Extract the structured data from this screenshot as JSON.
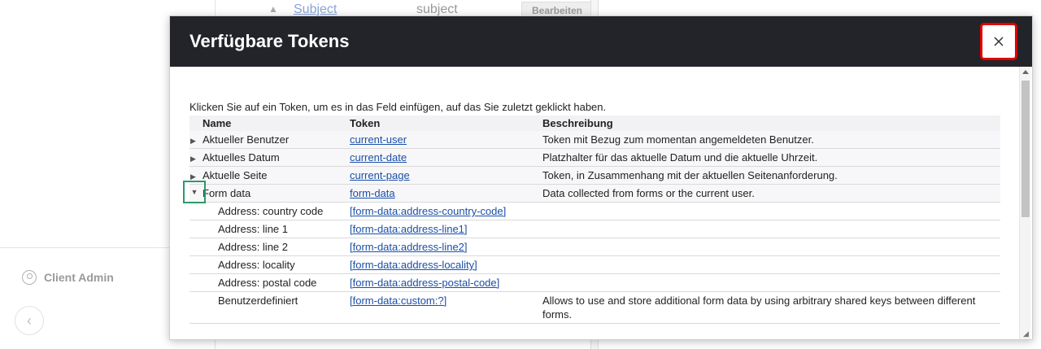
{
  "background": {
    "subject_link": "Subject",
    "subject_value": "subject",
    "edit_button": "Bearbeiten",
    "user_label": "Client Admin"
  },
  "dialog": {
    "title": "Verfügbare Tokens",
    "close_label": "×",
    "intro": "Klicken Sie auf ein Token, um es in das Feld einfügen, auf das Sie zuletzt geklickt haben.",
    "columns": {
      "name": "Name",
      "token": "Token",
      "description": "Beschreibung"
    },
    "rows": [
      {
        "name": "Aktueller Benutzer",
        "token": "current-user",
        "description": "Token mit Bezug zum momentan angemeldeten Benutzer."
      },
      {
        "name": "Aktuelles Datum",
        "token": "current-date",
        "description": "Platzhalter für das aktuelle Datum und die aktuelle Uhrzeit."
      },
      {
        "name": "Aktuelle Seite",
        "token": "current-page",
        "description": "Token, in Zusammenhang mit der aktuellen Seitenanforderung."
      },
      {
        "name": "Form data",
        "token": "form-data",
        "description": "Data collected from forms or the current user."
      },
      {
        "name": "Address: country code",
        "token": "[form-data:address-country-code]",
        "description": ""
      },
      {
        "name": "Address: line 1",
        "token": "[form-data:address-line1]",
        "description": ""
      },
      {
        "name": "Address: line 2",
        "token": "[form-data:address-line2]",
        "description": ""
      },
      {
        "name": "Address: locality",
        "token": "[form-data:address-locality]",
        "description": ""
      },
      {
        "name": "Address: postal code",
        "token": "[form-data:address-postal-code]",
        "description": ""
      },
      {
        "name": "Benutzerdefiniert",
        "token": "[form-data:custom:?]",
        "description": "Allows to use and store additional form data by using arbitrary shared keys between different forms."
      }
    ]
  },
  "icons": {
    "close": "close-icon",
    "expand": "triangle-right-icon",
    "collapse": "triangle-down-icon",
    "user": "user-circle-icon",
    "back": "chevron-left-icon"
  },
  "colors": {
    "header_bg": "#232429",
    "link": "#1a4fa8",
    "close_highlight": "#e00000",
    "expander_highlight": "#2e9a6b"
  }
}
